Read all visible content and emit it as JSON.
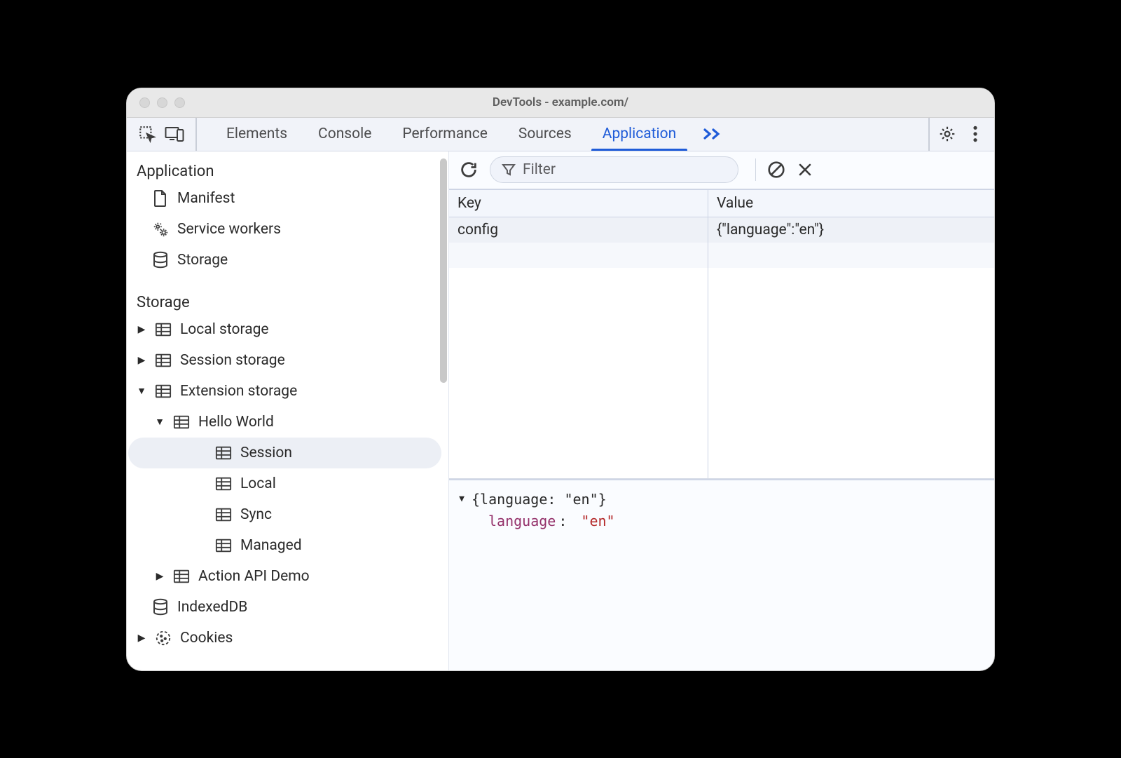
{
  "window_title": "DevTools - example.com/",
  "tabs": [
    {
      "label": "Elements",
      "active": false
    },
    {
      "label": "Console",
      "active": false
    },
    {
      "label": "Performance",
      "active": false
    },
    {
      "label": "Sources",
      "active": false
    },
    {
      "label": "Application",
      "active": true
    }
  ],
  "sidebar": {
    "sections": {
      "application": {
        "title": "Application",
        "items": [
          "Manifest",
          "Service workers",
          "Storage"
        ]
      },
      "storage": {
        "title": "Storage",
        "local": "Local storage",
        "session": "Session storage",
        "extension": "Extension storage",
        "hello_world": "Hello World",
        "ext_children": [
          "Session",
          "Local",
          "Sync",
          "Managed"
        ],
        "action_api": "Action API Demo",
        "indexeddb": "IndexedDB",
        "cookies": "Cookies"
      }
    }
  },
  "toolbar": {
    "filter_placeholder": "Filter"
  },
  "table": {
    "headers": {
      "key": "Key",
      "value": "Value"
    },
    "rows": [
      {
        "key": "config",
        "value": "{\"language\":\"en\"}"
      }
    ]
  },
  "preview": {
    "summary": "{language: \"en\"}",
    "prop_key": "language",
    "prop_value": "\"en\""
  }
}
